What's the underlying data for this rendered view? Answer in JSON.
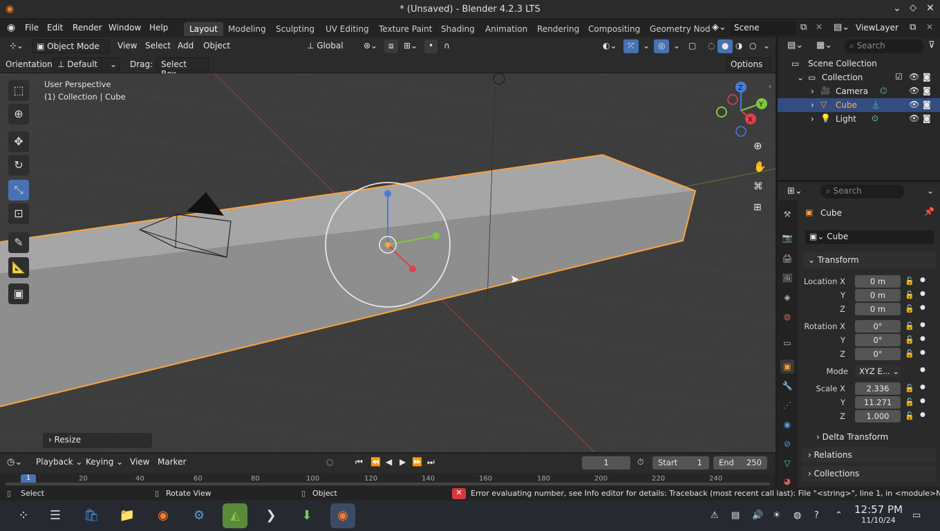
{
  "window": {
    "title": "* (Unsaved) - Blender 4.2.3 LTS"
  },
  "menu": [
    "File",
    "Edit",
    "Render",
    "Window",
    "Help"
  ],
  "workspaces": [
    "Layout",
    "Modeling",
    "Sculpting",
    "UV Editing",
    "Texture Paint",
    "Shading",
    "Animation",
    "Rendering",
    "Compositing",
    "Geometry Nod"
  ],
  "scene": {
    "label": "Scene",
    "viewlayer": "ViewLayer"
  },
  "header3d": {
    "mode": "Object Mode",
    "menus": [
      "View",
      "Select",
      "Add",
      "Object"
    ],
    "transform_orientation": "Global"
  },
  "toolsettings": {
    "orientation_label": "Orientation:",
    "orientation_value": "Default",
    "drag_label": "Drag:",
    "drag_value": "Select Box",
    "options": "Options"
  },
  "viewport": {
    "perspective": "User Perspective",
    "context": "(1) Collection | Cube",
    "last_op": "Resize",
    "gizmo": {
      "x": "X",
      "y": "Y",
      "z": "Z"
    }
  },
  "outliner": {
    "search_placeholder": "Search",
    "root": "Scene Collection",
    "collection": "Collection",
    "items": [
      {
        "name": "Camera",
        "selected": false
      },
      {
        "name": "Cube",
        "selected": true
      },
      {
        "name": "Light",
        "selected": false
      }
    ]
  },
  "properties": {
    "search_placeholder": "Search",
    "object_name": "Cube",
    "datablock": "Cube",
    "transform_title": "Transform",
    "location": {
      "label": "Location X",
      "x": "0 m",
      "y": "0 m",
      "z": "0 m"
    },
    "rotation": {
      "label": "Rotation X",
      "x": "0°",
      "y": "0°",
      "z": "0°"
    },
    "mode_label": "Mode",
    "mode_value": "XYZ E...",
    "scale": {
      "label": "Scale X",
      "x": "2.336",
      "y": "11.271",
      "z": "1.000"
    },
    "axis_y": "Y",
    "axis_z": "Z",
    "delta_transform": "Delta Transform",
    "relations": "Relations",
    "collections": "Collections"
  },
  "timeline": {
    "menus": [
      "Playback",
      "Keying",
      "View",
      "Marker"
    ],
    "current_frame": "1",
    "start_label": "Start",
    "start": "1",
    "end_label": "End",
    "end": "250",
    "ruler": [
      "1",
      "20",
      "40",
      "60",
      "80",
      "100",
      "120",
      "140",
      "160",
      "180",
      "200",
      "220",
      "240"
    ]
  },
  "status": {
    "select": "Select",
    "rotate": "Rotate View",
    "object": "Object",
    "error": "Error evaluating number, see Info editor for details: Traceback (most recent call last):  File \"<string>\", line 1, in <module>NameEr"
  },
  "taskbar": {
    "time": "12:57 PM",
    "date": "11/10/24"
  },
  "colors": {
    "accent_blue": "#4772b3",
    "selection_orange": "#ffa13d",
    "error_red": "#d9363e"
  }
}
